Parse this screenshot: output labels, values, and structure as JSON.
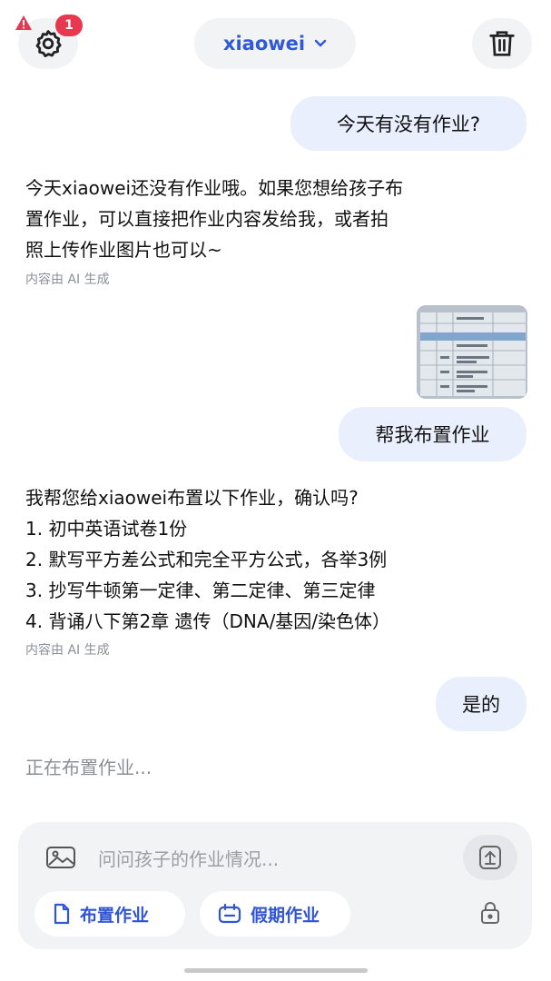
{
  "header": {
    "settings_badge": "1",
    "title": "xiaowei"
  },
  "messages": {
    "user1": "今天有没有作业?",
    "ai1_lines": [
      "今天xiaowei还没有作业哦。如果您想给孩子布",
      "置作业，可以直接把作业内容发给我，或者拍",
      "照上传作业图片也可以~"
    ],
    "ai1_note": "内容由 AI 生成",
    "user2": "帮我布置作业",
    "ai2_lines": [
      "我帮您给xiaowei布置以下作业，确认吗?",
      "1. 初中英语试卷1份",
      "2. 默写平方差公式和完全平方公式，各举3例",
      "3. 抄写牛顿第一定律、第二定律、第三定律",
      "4. 背诵八下第2章 遗传（DNA/基因/染色体）"
    ],
    "ai2_note": "内容由 AI 生成",
    "user3": "是的",
    "status": "正在布置作业..."
  },
  "composer": {
    "placeholder": "问问孩子的作业情况...",
    "chip1": "布置作业",
    "chip2": "假期作业"
  },
  "colors": {
    "accent": "#3159d6",
    "bubble": "#e9effc",
    "badge": "#e8384f",
    "surface": "#f2f3f5"
  },
  "icons": [
    "settings-gear-icon",
    "warning-icon",
    "chevron-down-icon",
    "trash-icon",
    "image-icon",
    "upload-icon",
    "document-icon",
    "calendar-icon",
    "lock-icon"
  ]
}
